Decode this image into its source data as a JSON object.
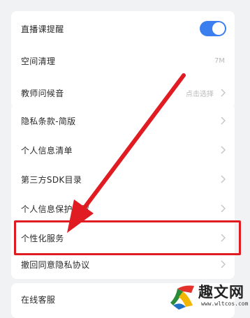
{
  "card1": {
    "live_reminder": {
      "label": "直播课提醒",
      "toggle_on": true
    },
    "space_clean": {
      "label": "空间清理",
      "value": "7M"
    },
    "teacher_greeting": {
      "label": "教师问候音",
      "value": "点击选择"
    }
  },
  "card2": {
    "items": [
      {
        "label": "隐私条款-简版"
      },
      {
        "label": "个人信息清单"
      },
      {
        "label": "第三方SDK目录"
      },
      {
        "label": "个人信息保护设置"
      },
      {
        "label": "个性化服务"
      },
      {
        "label": "撤回同意隐私协议"
      }
    ]
  },
  "card3": {
    "online_service": {
      "label": "在线客服"
    }
  },
  "watermark": {
    "title": "趣文网",
    "url": "www.wltcos.com"
  },
  "colors": {
    "accent": "#3b7ef0",
    "highlight": "#e11b22",
    "background": "#f1f2f4"
  }
}
